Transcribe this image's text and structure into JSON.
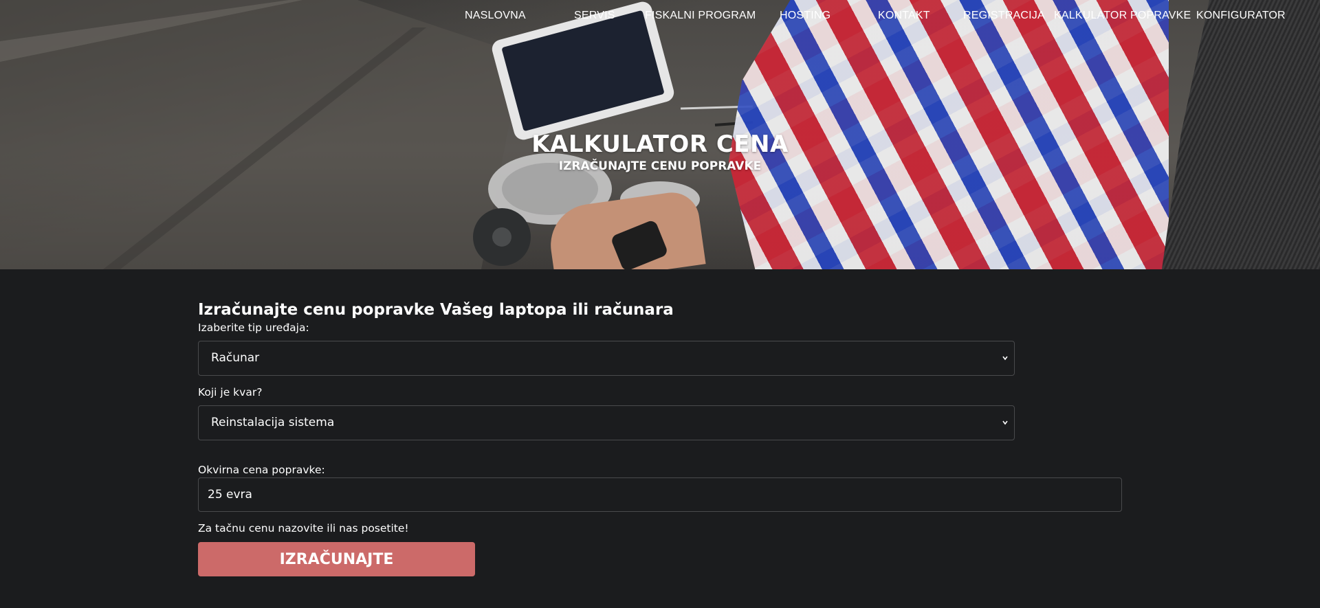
{
  "nav": {
    "items": [
      {
        "label": "NASLOVNA"
      },
      {
        "label": "SERVIS"
      },
      {
        "label": "FISKALNI PROGRAM"
      },
      {
        "label": "HOSTING"
      },
      {
        "label": "KONTAKT"
      },
      {
        "label": "REGISTRACIJA"
      },
      {
        "label": "KALKULATOR POPRAVKE"
      },
      {
        "label": "KONFIGURATOR"
      }
    ]
  },
  "hero": {
    "title": "KALKULATOR CENA",
    "subtitle": "IZRAČUNAJTE CENU POPRAVKE"
  },
  "form": {
    "heading": "Izračunajte cenu popravke Vašeg laptopa ili računara",
    "device_label": "Izaberite tip uređaja:",
    "device_value": "Računar",
    "fault_label": "Koji je kvar?",
    "fault_value": "Reinstalacija sistema",
    "price_label": "Okvirna cena popravke:",
    "price_value": "25 evra",
    "note": "Za tačnu cenu nazovite ili nas posetite!",
    "button_label": "IZRAČUNAJTE"
  },
  "colors": {
    "background": "#1b1c1e",
    "button": "#cc6a69",
    "text": "#ffffff"
  }
}
